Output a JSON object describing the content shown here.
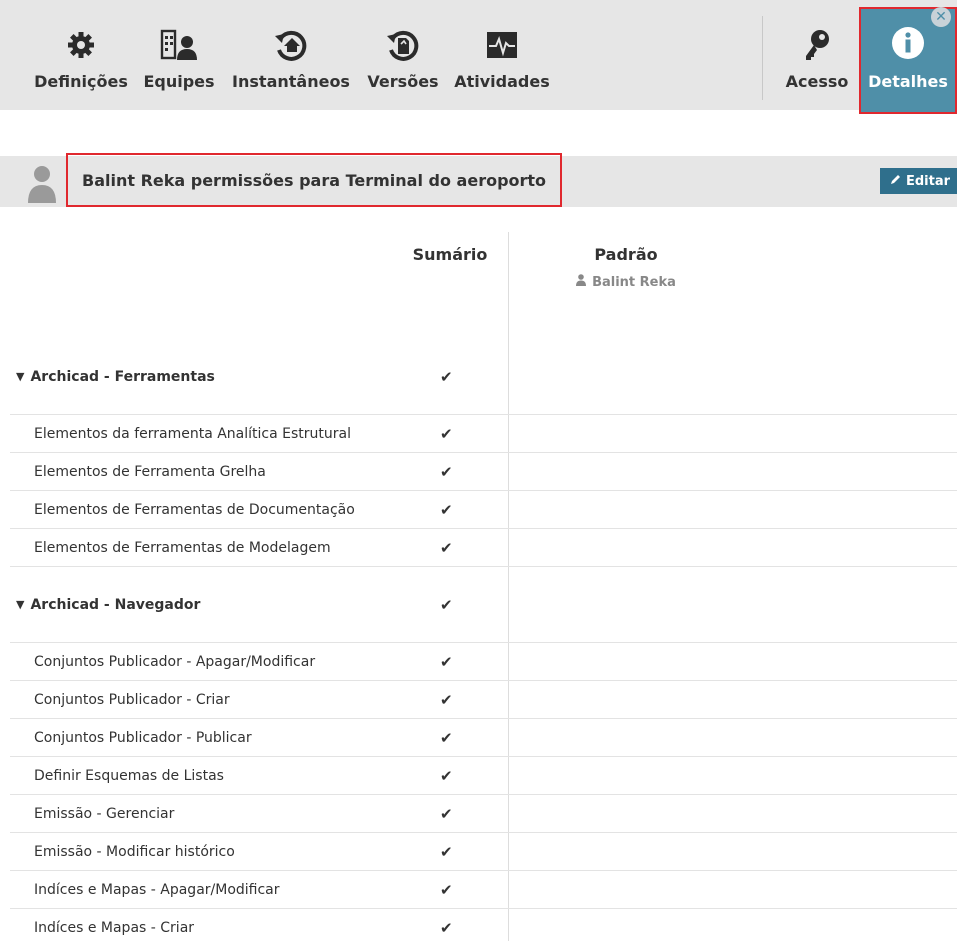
{
  "toolbar": {
    "items": [
      {
        "label": "Definições",
        "icon": "gear-icon"
      },
      {
        "label": "Equipes",
        "icon": "team-icon"
      },
      {
        "label": "Instantâneos",
        "icon": "snapshot-icon"
      },
      {
        "label": "Versões",
        "icon": "versions-icon"
      },
      {
        "label": "Atividades",
        "icon": "activity-icon"
      },
      {
        "label": "Acesso",
        "icon": "key-icon"
      }
    ],
    "detalhes": {
      "label": "Detalhes",
      "icon": "info-icon",
      "close": "✕"
    }
  },
  "header": {
    "title": "Balint Reka permissões para Terminal do aeroporto",
    "edit_label": "Editar"
  },
  "columns": {
    "summary": "Sumário",
    "default": "Padrão",
    "default_user": "Balint Reka"
  },
  "groups": [
    {
      "name": "Archicad - Ferramentas",
      "check": "✔",
      "rows": [
        {
          "name": "Elementos da ferramenta Analítica Estrutural",
          "check": "✔"
        },
        {
          "name": "Elementos de Ferramenta Grelha",
          "check": "✔"
        },
        {
          "name": "Elementos de Ferramentas de Documentação",
          "check": "✔"
        },
        {
          "name": "Elementos de Ferramentas de Modelagem",
          "check": "✔"
        }
      ]
    },
    {
      "name": "Archicad - Navegador",
      "check": "✔",
      "rows": [
        {
          "name": "Conjuntos Publicador - Apagar/Modificar",
          "check": "✔"
        },
        {
          "name": "Conjuntos Publicador - Criar",
          "check": "✔"
        },
        {
          "name": "Conjuntos Publicador - Publicar",
          "check": "✔"
        },
        {
          "name": "Definir Esquemas de Listas",
          "check": "✔"
        },
        {
          "name": "Emissão - Gerenciar",
          "check": "✔"
        },
        {
          "name": "Emissão - Modificar histórico",
          "check": "✔"
        },
        {
          "name": "Indíces e Mapas - Apagar/Modificar",
          "check": "✔"
        },
        {
          "name": "Indíces e Mapas - Criar",
          "check": "✔"
        }
      ]
    }
  ]
}
